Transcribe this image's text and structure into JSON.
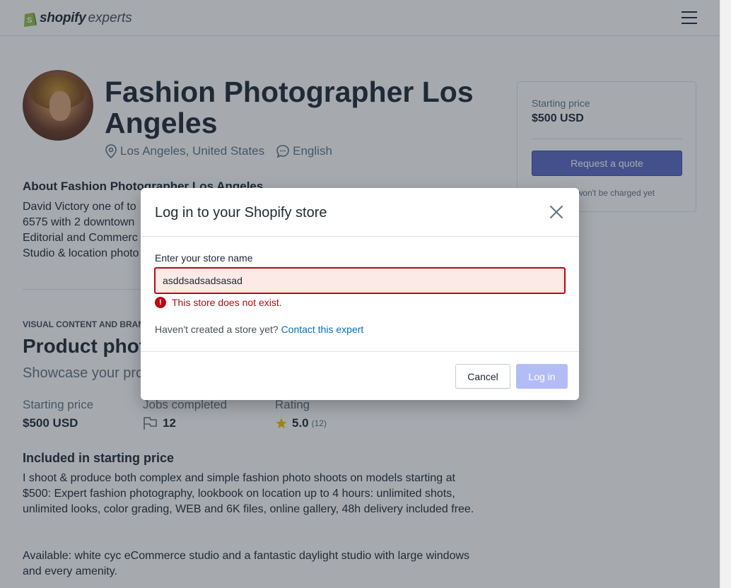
{
  "header": {
    "logo_brand": "shopify",
    "logo_suffix": "experts",
    "menu_icon": "hamburger-menu-icon"
  },
  "profile": {
    "title": "Fashion Photographer Los Angeles",
    "location": "Los Angeles, United States",
    "language": "English",
    "about_heading": "About Fashion Photographer Los Angeles",
    "about_lines": [
      "David Victory one of to",
      "6575 with 2 downtown",
      "Editorial and Commerc",
      "Studio & location photo"
    ]
  },
  "service": {
    "kicker": "VISUAL CONTENT AND BRAND",
    "title": "Product phot",
    "subtitle": "Showcase your pro",
    "starting_price_label": "Starting price",
    "starting_price": "$500 USD",
    "jobs_label": "Jobs completed",
    "jobs_value": "12",
    "rating_label": "Rating",
    "rating_value": "5.0",
    "rating_count": "(12)",
    "included_heading": "Included in starting price",
    "included_text": "I shoot & produce both complex and simple fashion photo shoots on models starting at $500: Expert fashion photography, lookbook on location up to 4 hours: unlimited shots, unlimited looks, color grading, WEB and 6K files, online gallery, 48h delivery included free.",
    "available_text": "Available: white cyc eCommerce studio and a fantastic daylight studio with large windows and every amenity."
  },
  "price_card": {
    "label": "Starting price",
    "price": "$500 USD",
    "button": "Request a quote",
    "note": "You won't be charged yet"
  },
  "modal": {
    "title": "Log in to your Shopify store",
    "field_label": "Enter your store name",
    "field_value": "asddsadsadsasad",
    "error_text": "This store does not exist.",
    "help_prefix": "Haven't created a store yet?",
    "help_link": "Contact this expert",
    "cancel": "Cancel",
    "login": "Log in"
  },
  "colors": {
    "accent": "#5c6ac4",
    "error": "#bf0711",
    "link": "#006fbb"
  }
}
